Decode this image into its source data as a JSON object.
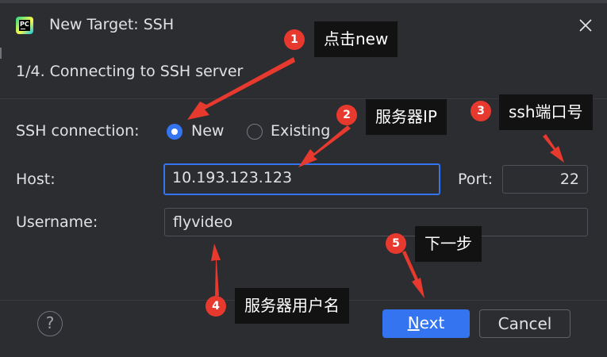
{
  "window": {
    "title": "New Target: SSH"
  },
  "step": {
    "text": "1/4. Connecting to SSH server"
  },
  "form": {
    "ssh_connection_label": "SSH connection:",
    "option_new": "New",
    "option_existing": "Existing",
    "host_label": "Host:",
    "host_value": "10.193.123.123",
    "port_label": "Port:",
    "port_value": "22",
    "username_label": "Username:",
    "username_value": "flyvideo"
  },
  "footer": {
    "help": "?",
    "next_rest": "ext",
    "next_mnemonic": "N",
    "cancel": "Cancel"
  },
  "annotations": [
    {
      "number": "1",
      "text": "点击new"
    },
    {
      "number": "2",
      "text": "服务器IP"
    },
    {
      "number": "3",
      "text": "ssh端口号"
    },
    {
      "number": "4",
      "text": "服务器用户名"
    },
    {
      "number": "5",
      "text": "下一步"
    }
  ],
  "colors": {
    "background": "#2b2d30",
    "accent": "#3574f0",
    "annotation_red": "#e8392f",
    "annotation_box": "#121212"
  },
  "icons": {
    "app": "pycharm-logo-icon",
    "close": "close-icon",
    "help": "help-icon"
  }
}
